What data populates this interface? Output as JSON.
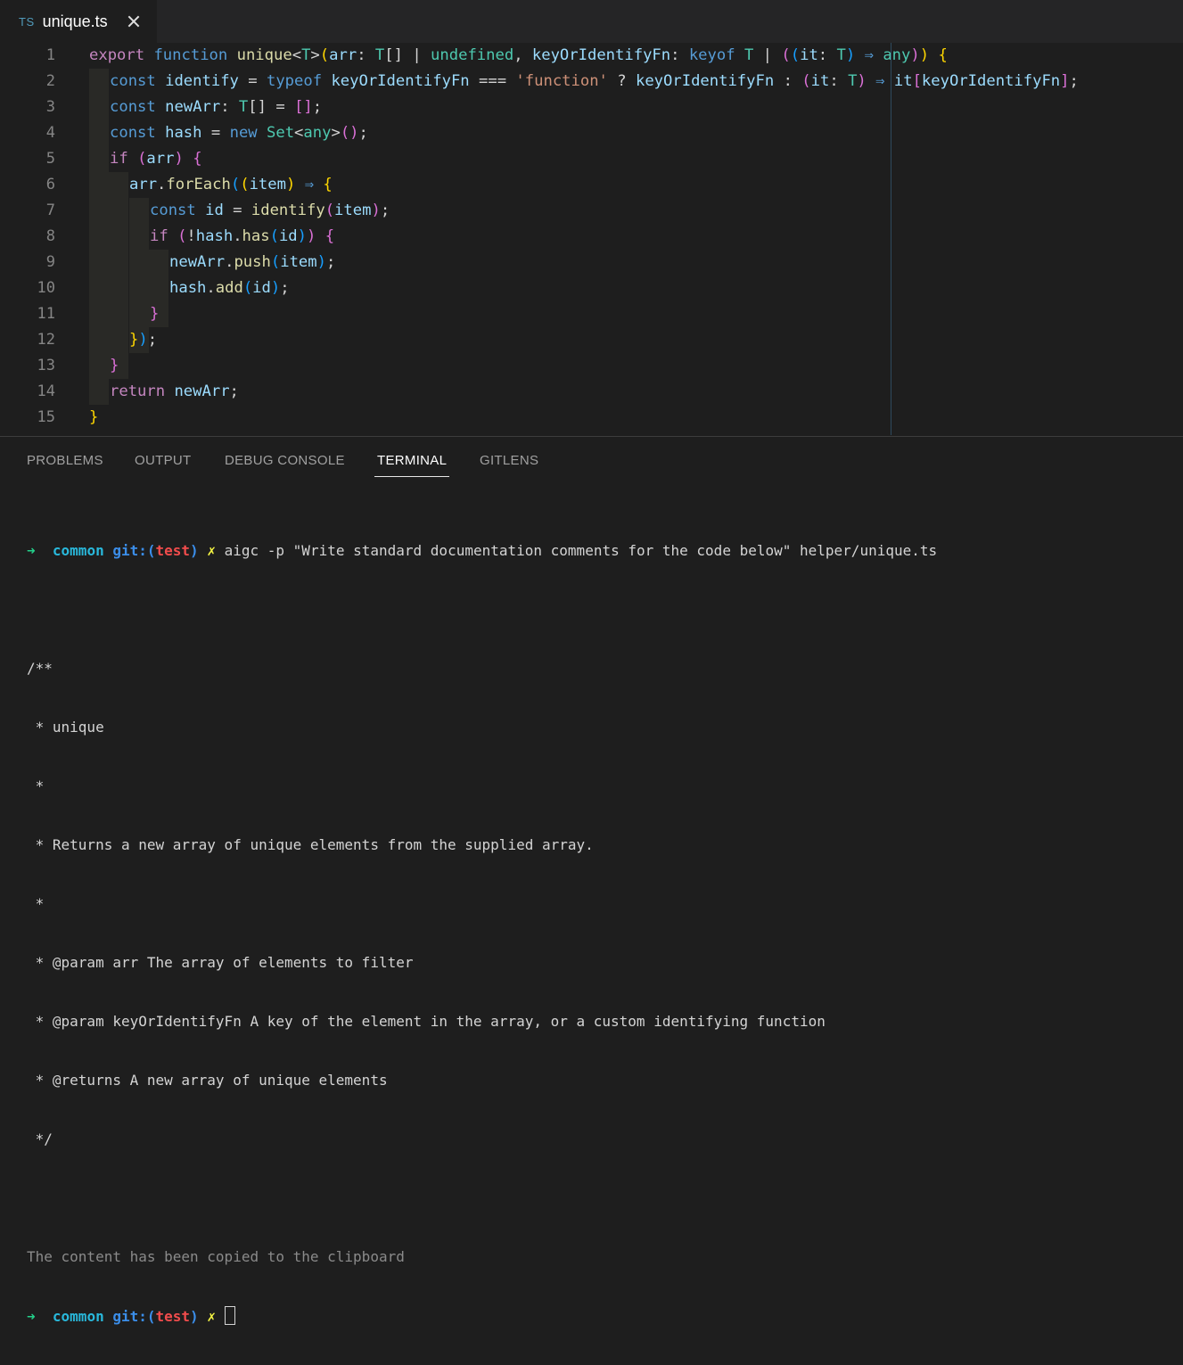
{
  "tab": {
    "badge": "TS",
    "title": "unique.ts"
  },
  "editor": {
    "line_numbers": [
      "1",
      "2",
      "3",
      "4",
      "5",
      "6",
      "7",
      "8",
      "9",
      "10",
      "11",
      "12",
      "13",
      "14",
      "15"
    ]
  },
  "panel": {
    "tabs": [
      "PROBLEMS",
      "OUTPUT",
      "DEBUG CONSOLE",
      "TERMINAL",
      "GITLENS"
    ],
    "active_tab": "TERMINAL"
  },
  "terminal": {
    "prompt_arrow": "➜",
    "prompt_dir": "common",
    "prompt_git": "git:(",
    "prompt_branch": "test",
    "prompt_git_close": ")",
    "prompt_dirty": "✗",
    "command": "aigc -p \"Write standard documentation comments for the code below\" helper/unique.ts",
    "output_lines": [
      "/**",
      " * unique",
      " *",
      " * Returns a new array of unique elements from the supplied array.",
      " *",
      " * @param arr The array of elements to filter",
      " * @param keyOrIdentifyFn A key of the element in the array, or a custom identifying function",
      " * @returns A new array of unique elements",
      " */"
    ],
    "status": "The content has been copied to the clipboard"
  },
  "code": {
    "l1": [
      [
        "export",
        "kc"
      ],
      [
        " ",
        "ws"
      ],
      [
        "function",
        "kw"
      ],
      [
        " ",
        "ws"
      ],
      [
        "unique",
        "fn"
      ],
      [
        "<",
        "op"
      ],
      [
        "T",
        "ty"
      ],
      [
        ">",
        "op"
      ],
      [
        "(",
        "br1"
      ],
      [
        "arr",
        "var"
      ],
      [
        ":",
        "op"
      ],
      [
        " ",
        "ws"
      ],
      [
        "T",
        "ty"
      ],
      [
        "[]",
        "op"
      ],
      [
        " ",
        "ws"
      ],
      [
        "|",
        "op"
      ],
      [
        " ",
        "ws"
      ],
      [
        "undefined",
        "ty"
      ],
      [
        ", ",
        "op"
      ],
      [
        "keyOrIdentifyFn",
        "var"
      ],
      [
        ":",
        "op"
      ],
      [
        " ",
        "ws"
      ],
      [
        "keyof",
        "kw"
      ],
      [
        " ",
        "ws"
      ],
      [
        "T",
        "ty"
      ],
      [
        " ",
        "ws"
      ],
      [
        "|",
        "op"
      ],
      [
        " ",
        "ws"
      ],
      [
        "(",
        "br2"
      ],
      [
        "(",
        "br3"
      ],
      [
        "it",
        "var"
      ],
      [
        ":",
        "op"
      ],
      [
        " ",
        "ws"
      ],
      [
        "T",
        "ty"
      ],
      [
        ")",
        "br3"
      ],
      [
        " ",
        "ws"
      ],
      [
        "⇒",
        "kw"
      ],
      [
        " ",
        "ws"
      ],
      [
        "any",
        "ty"
      ],
      [
        ")",
        "br2"
      ],
      [
        ")",
        "br1"
      ],
      [
        " ",
        "ws"
      ],
      [
        "{",
        "br1"
      ]
    ],
    "l2": [
      [
        "const",
        "kw"
      ],
      [
        " ",
        "ws"
      ],
      [
        "identify",
        "var"
      ],
      [
        " ",
        "ws"
      ],
      [
        "=",
        "op"
      ],
      [
        " ",
        "ws"
      ],
      [
        "typeof",
        "kw"
      ],
      [
        " ",
        "ws"
      ],
      [
        "keyOrIdentifyFn",
        "var"
      ],
      [
        " ",
        "ws"
      ],
      [
        "===",
        "op"
      ],
      [
        " ",
        "ws"
      ],
      [
        "'function'",
        "str"
      ],
      [
        " ",
        "ws"
      ],
      [
        "?",
        "op"
      ],
      [
        " ",
        "ws"
      ],
      [
        "keyOrIdentifyFn",
        "var"
      ],
      [
        " ",
        "ws"
      ],
      [
        ":",
        "op"
      ],
      [
        " ",
        "ws"
      ],
      [
        "(",
        "br2"
      ],
      [
        "it",
        "var"
      ],
      [
        ":",
        "op"
      ],
      [
        " ",
        "ws"
      ],
      [
        "T",
        "ty"
      ],
      [
        ")",
        "br2"
      ],
      [
        " ",
        "ws"
      ],
      [
        "⇒",
        "kw"
      ],
      [
        " ",
        "ws"
      ],
      [
        "it",
        "var"
      ],
      [
        "[",
        "br2"
      ],
      [
        "keyOrIdentifyFn",
        "var"
      ],
      [
        "]",
        "br2"
      ],
      [
        ";",
        "op"
      ]
    ],
    "l3": [
      [
        "const",
        "kw"
      ],
      [
        " ",
        "ws"
      ],
      [
        "newArr",
        "var"
      ],
      [
        ":",
        "op"
      ],
      [
        " ",
        "ws"
      ],
      [
        "T",
        "ty"
      ],
      [
        "[]",
        "op"
      ],
      [
        " ",
        "ws"
      ],
      [
        "=",
        "op"
      ],
      [
        " ",
        "ws"
      ],
      [
        "[]",
        "br2"
      ],
      [
        ";",
        "op"
      ]
    ],
    "l4": [
      [
        "const",
        "kw"
      ],
      [
        " ",
        "ws"
      ],
      [
        "hash",
        "var"
      ],
      [
        " ",
        "ws"
      ],
      [
        "=",
        "op"
      ],
      [
        " ",
        "ws"
      ],
      [
        "new",
        "kw"
      ],
      [
        " ",
        "ws"
      ],
      [
        "Set",
        "ty"
      ],
      [
        "<",
        "op"
      ],
      [
        "any",
        "ty"
      ],
      [
        ">",
        "op"
      ],
      [
        "()",
        "br2"
      ],
      [
        ";",
        "op"
      ]
    ],
    "l5": [
      [
        "if",
        "kc"
      ],
      [
        " ",
        "ws"
      ],
      [
        "(",
        "br2"
      ],
      [
        "arr",
        "var"
      ],
      [
        ")",
        "br2"
      ],
      [
        " ",
        "ws"
      ],
      [
        "{",
        "br2"
      ]
    ],
    "l6": [
      [
        "arr",
        "var"
      ],
      [
        ".",
        "op"
      ],
      [
        "forEach",
        "fn"
      ],
      [
        "(",
        "br3"
      ],
      [
        "(",
        "br1"
      ],
      [
        "item",
        "var"
      ],
      [
        ")",
        "br1"
      ],
      [
        " ",
        "ws"
      ],
      [
        "⇒",
        "kw"
      ],
      [
        " ",
        "ws"
      ],
      [
        "{",
        "br1"
      ]
    ],
    "l7": [
      [
        "const",
        "kw"
      ],
      [
        " ",
        "ws"
      ],
      [
        "id",
        "var"
      ],
      [
        " ",
        "ws"
      ],
      [
        "=",
        "op"
      ],
      [
        " ",
        "ws"
      ],
      [
        "identify",
        "fn"
      ],
      [
        "(",
        "br2"
      ],
      [
        "item",
        "var"
      ],
      [
        ")",
        "br2"
      ],
      [
        ";",
        "op"
      ]
    ],
    "l8": [
      [
        "if",
        "kc"
      ],
      [
        " ",
        "ws"
      ],
      [
        "(",
        "br2"
      ],
      [
        "!",
        "op"
      ],
      [
        "hash",
        "var"
      ],
      [
        ".",
        "op"
      ],
      [
        "has",
        "fn"
      ],
      [
        "(",
        "br3"
      ],
      [
        "id",
        "var"
      ],
      [
        ")",
        "br3"
      ],
      [
        ")",
        "br2"
      ],
      [
        " ",
        "ws"
      ],
      [
        "{",
        "br2"
      ]
    ],
    "l9": [
      [
        "newArr",
        "var"
      ],
      [
        ".",
        "op"
      ],
      [
        "push",
        "fn"
      ],
      [
        "(",
        "br3"
      ],
      [
        "item",
        "var"
      ],
      [
        ")",
        "br3"
      ],
      [
        ";",
        "op"
      ]
    ],
    "l10": [
      [
        "hash",
        "var"
      ],
      [
        ".",
        "op"
      ],
      [
        "add",
        "fn"
      ],
      [
        "(",
        "br3"
      ],
      [
        "id",
        "var"
      ],
      [
        ")",
        "br3"
      ],
      [
        ";",
        "op"
      ]
    ],
    "l11": [
      [
        "}",
        "br2"
      ]
    ],
    "l12": [
      [
        "}",
        "br1"
      ],
      [
        ")",
        "br3"
      ],
      [
        ";",
        "op"
      ]
    ],
    "l13": [
      [
        "}",
        "br2"
      ]
    ],
    "l14": [
      [
        "return",
        "kc"
      ],
      [
        " ",
        "ws"
      ],
      [
        "newArr",
        "var"
      ],
      [
        ";",
        "op"
      ]
    ],
    "l15": [
      [
        "}",
        "br1"
      ]
    ]
  }
}
